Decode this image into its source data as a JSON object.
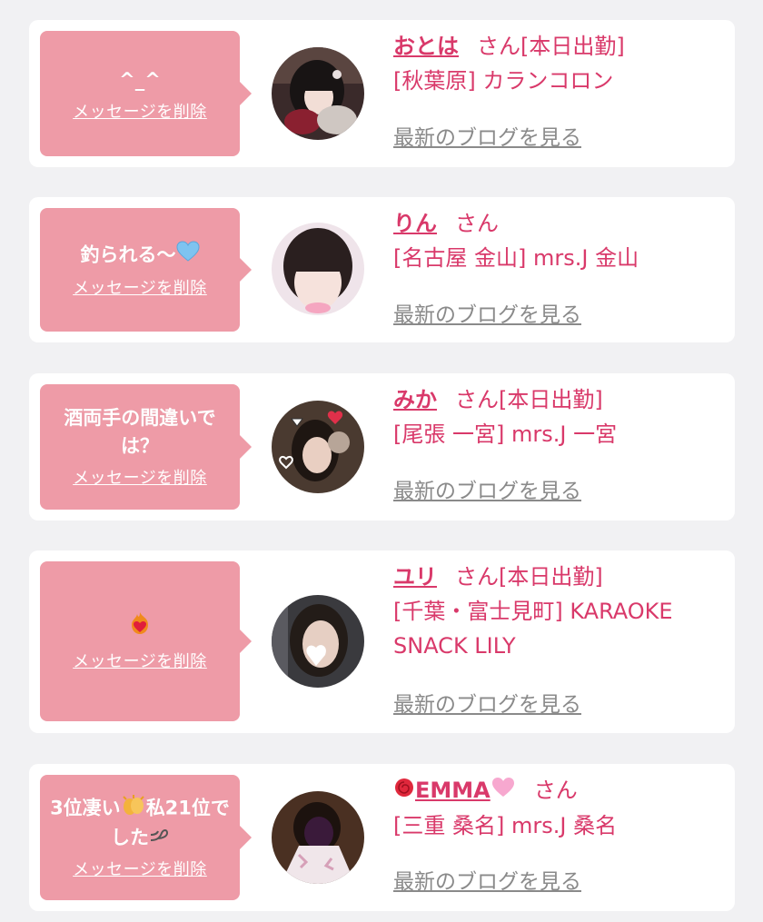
{
  "cards": [
    {
      "message": "^_^",
      "delete_label": "メッセージを削除",
      "name": "おとは",
      "suffix": "さん[本日出勤]",
      "shop": "[秋葉原] カランコロン",
      "blog_label": "最新のブログを見る"
    },
    {
      "message": "釣られる〜",
      "message_icon": "light-blue-heart-icon",
      "delete_label": "メッセージを削除",
      "name": "りん",
      "suffix": "さん",
      "shop": "[名古屋 金山] mrs.J 金山",
      "blog_label": "最新のブログを見る"
    },
    {
      "message": "酒両手の間違いでは？",
      "delete_label": "メッセージを削除",
      "name": "みか",
      "suffix": "さん[本日出勤]",
      "shop": "[尾張 一宮] mrs.J 一宮",
      "blog_label": "最新のブログを見る"
    },
    {
      "message": "",
      "message_icon": "heart-on-fire-icon",
      "delete_label": "メッセージを削除",
      "name": "ユリ",
      "suffix": "さん[本日出勤]",
      "shop": "[千葉・富士見町] KARAOKE SNACK LILY",
      "blog_label": "最新のブログを見る"
    },
    {
      "message_part1": "3位凄い",
      "message_part2": "私21位でした",
      "message_icons": [
        "clapping-hands-icon",
        "dashing-away-icon"
      ],
      "delete_label": "メッセージを削除",
      "name": "EMMA",
      "name_icons": [
        "rose-icon",
        "pink-heart-icon"
      ],
      "suffix": "さん",
      "shop": "[三重 桑名] mrs.J 桑名",
      "blog_label": "最新のブログを見る"
    }
  ],
  "colors": {
    "bubble": "#ee9ba7",
    "accent": "#d9396a",
    "muted": "#8a8a8a",
    "background": "#f1f1f3"
  }
}
